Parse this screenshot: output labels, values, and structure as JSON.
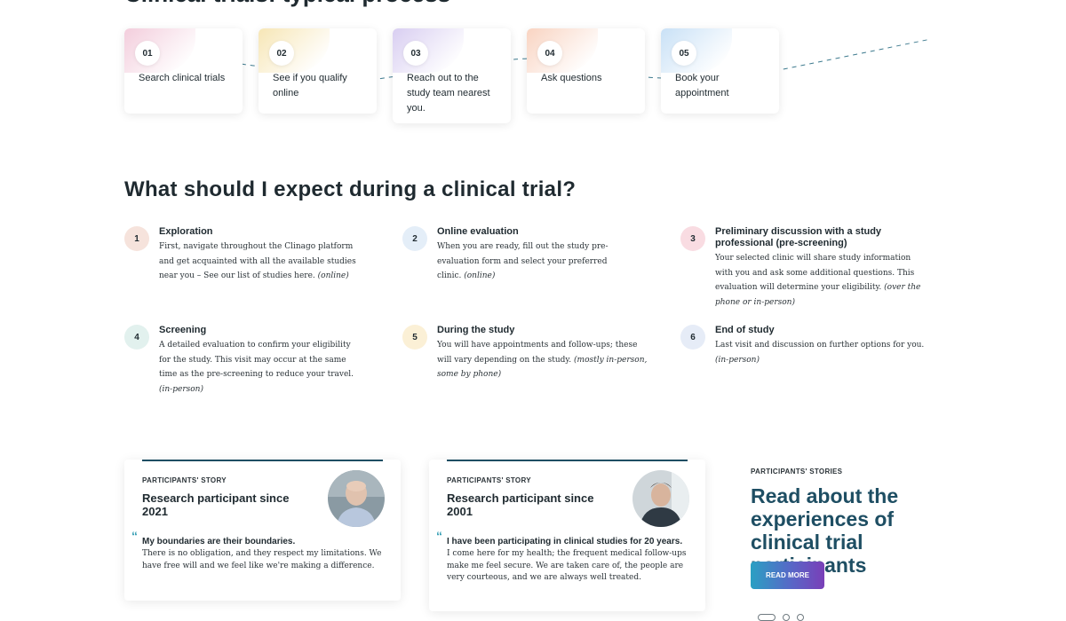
{
  "process": {
    "heading": "Clinical trials: typical process",
    "steps": [
      {
        "num": "01",
        "text": "Search clinical trials",
        "tint": "#e9a5c0"
      },
      {
        "num": "02",
        "text": "See if you qualify online",
        "tint": "#f0d27a"
      },
      {
        "num": "03",
        "text": "Reach out to the study team nearest you.",
        "tint": "#b9a6e6"
      },
      {
        "num": "04",
        "text": "Ask questions",
        "tint": "#f4b08f"
      },
      {
        "num": "05",
        "text": "Book your appointment",
        "tint": "#9cc8ef"
      }
    ]
  },
  "expect": {
    "title": "What should I expect during a clinical trial?",
    "items": [
      {
        "num": "1",
        "heading": "Exploration",
        "desc": "First, navigate throughout the Clinago platform and get acquainted with all the available studies near you – See our list of studies here.",
        "note": "(online)",
        "color": "#f6e3dc"
      },
      {
        "num": "2",
        "heading": "Online evaluation",
        "desc": "When you are ready, fill out the study pre-evaluation form and select your preferred clinic.",
        "note": "(online)",
        "color": "#e4eef8"
      },
      {
        "num": "3",
        "heading": "Preliminary discussion with a study professional (pre-screening)",
        "desc": "Your selected clinic will share study information with you and ask some additional questions. This evaluation will determine your eligibility.",
        "note": "(over the phone or in-person)",
        "color": "#f9dce2"
      },
      {
        "num": "4",
        "heading": "Screening",
        "desc": "A detailed evaluation to confirm your eligibility for the study. This visit may occur at the same time as the pre-screening to reduce your travel.",
        "note": "(in-person)",
        "color": "#e2f1ee"
      },
      {
        "num": "5",
        "heading": "During the study",
        "desc": "You will have appointments and follow-ups; these will vary depending on the study.",
        "note": "(mostly in-person, some by phone)",
        "color": "#fbf0d6"
      },
      {
        "num": "6",
        "heading": "End of study",
        "desc": "Last visit and discussion on further options for you.",
        "note": "(in-person)",
        "color": "#e6ecf7"
      }
    ]
  },
  "stories": [
    {
      "tag": "PARTICIPANTS' STORY",
      "heading": "Research participant since 2021",
      "quote": "My boundaries are their boundaries.",
      "body": "There is no obligation, and they respect my limitations. We have free will and we feel like we're making a difference.",
      "avatar": "bald-man"
    },
    {
      "tag": "PARTICIPANTS' STORY",
      "heading": "Research participant since 2001",
      "quote": "I have been participating in clinical studies for 20 years.",
      "body": "I come here for my health; the frequent medical follow-ups make me feel secure. We are taken care of, the people are very courteous, and we are always well treated.",
      "avatar": "dark-haired-man"
    }
  ],
  "stories_section": {
    "tag": "PARTICIPANTS' STORIES",
    "title": "Read about the experiences of clinical trial participants",
    "button": "READ MORE"
  }
}
